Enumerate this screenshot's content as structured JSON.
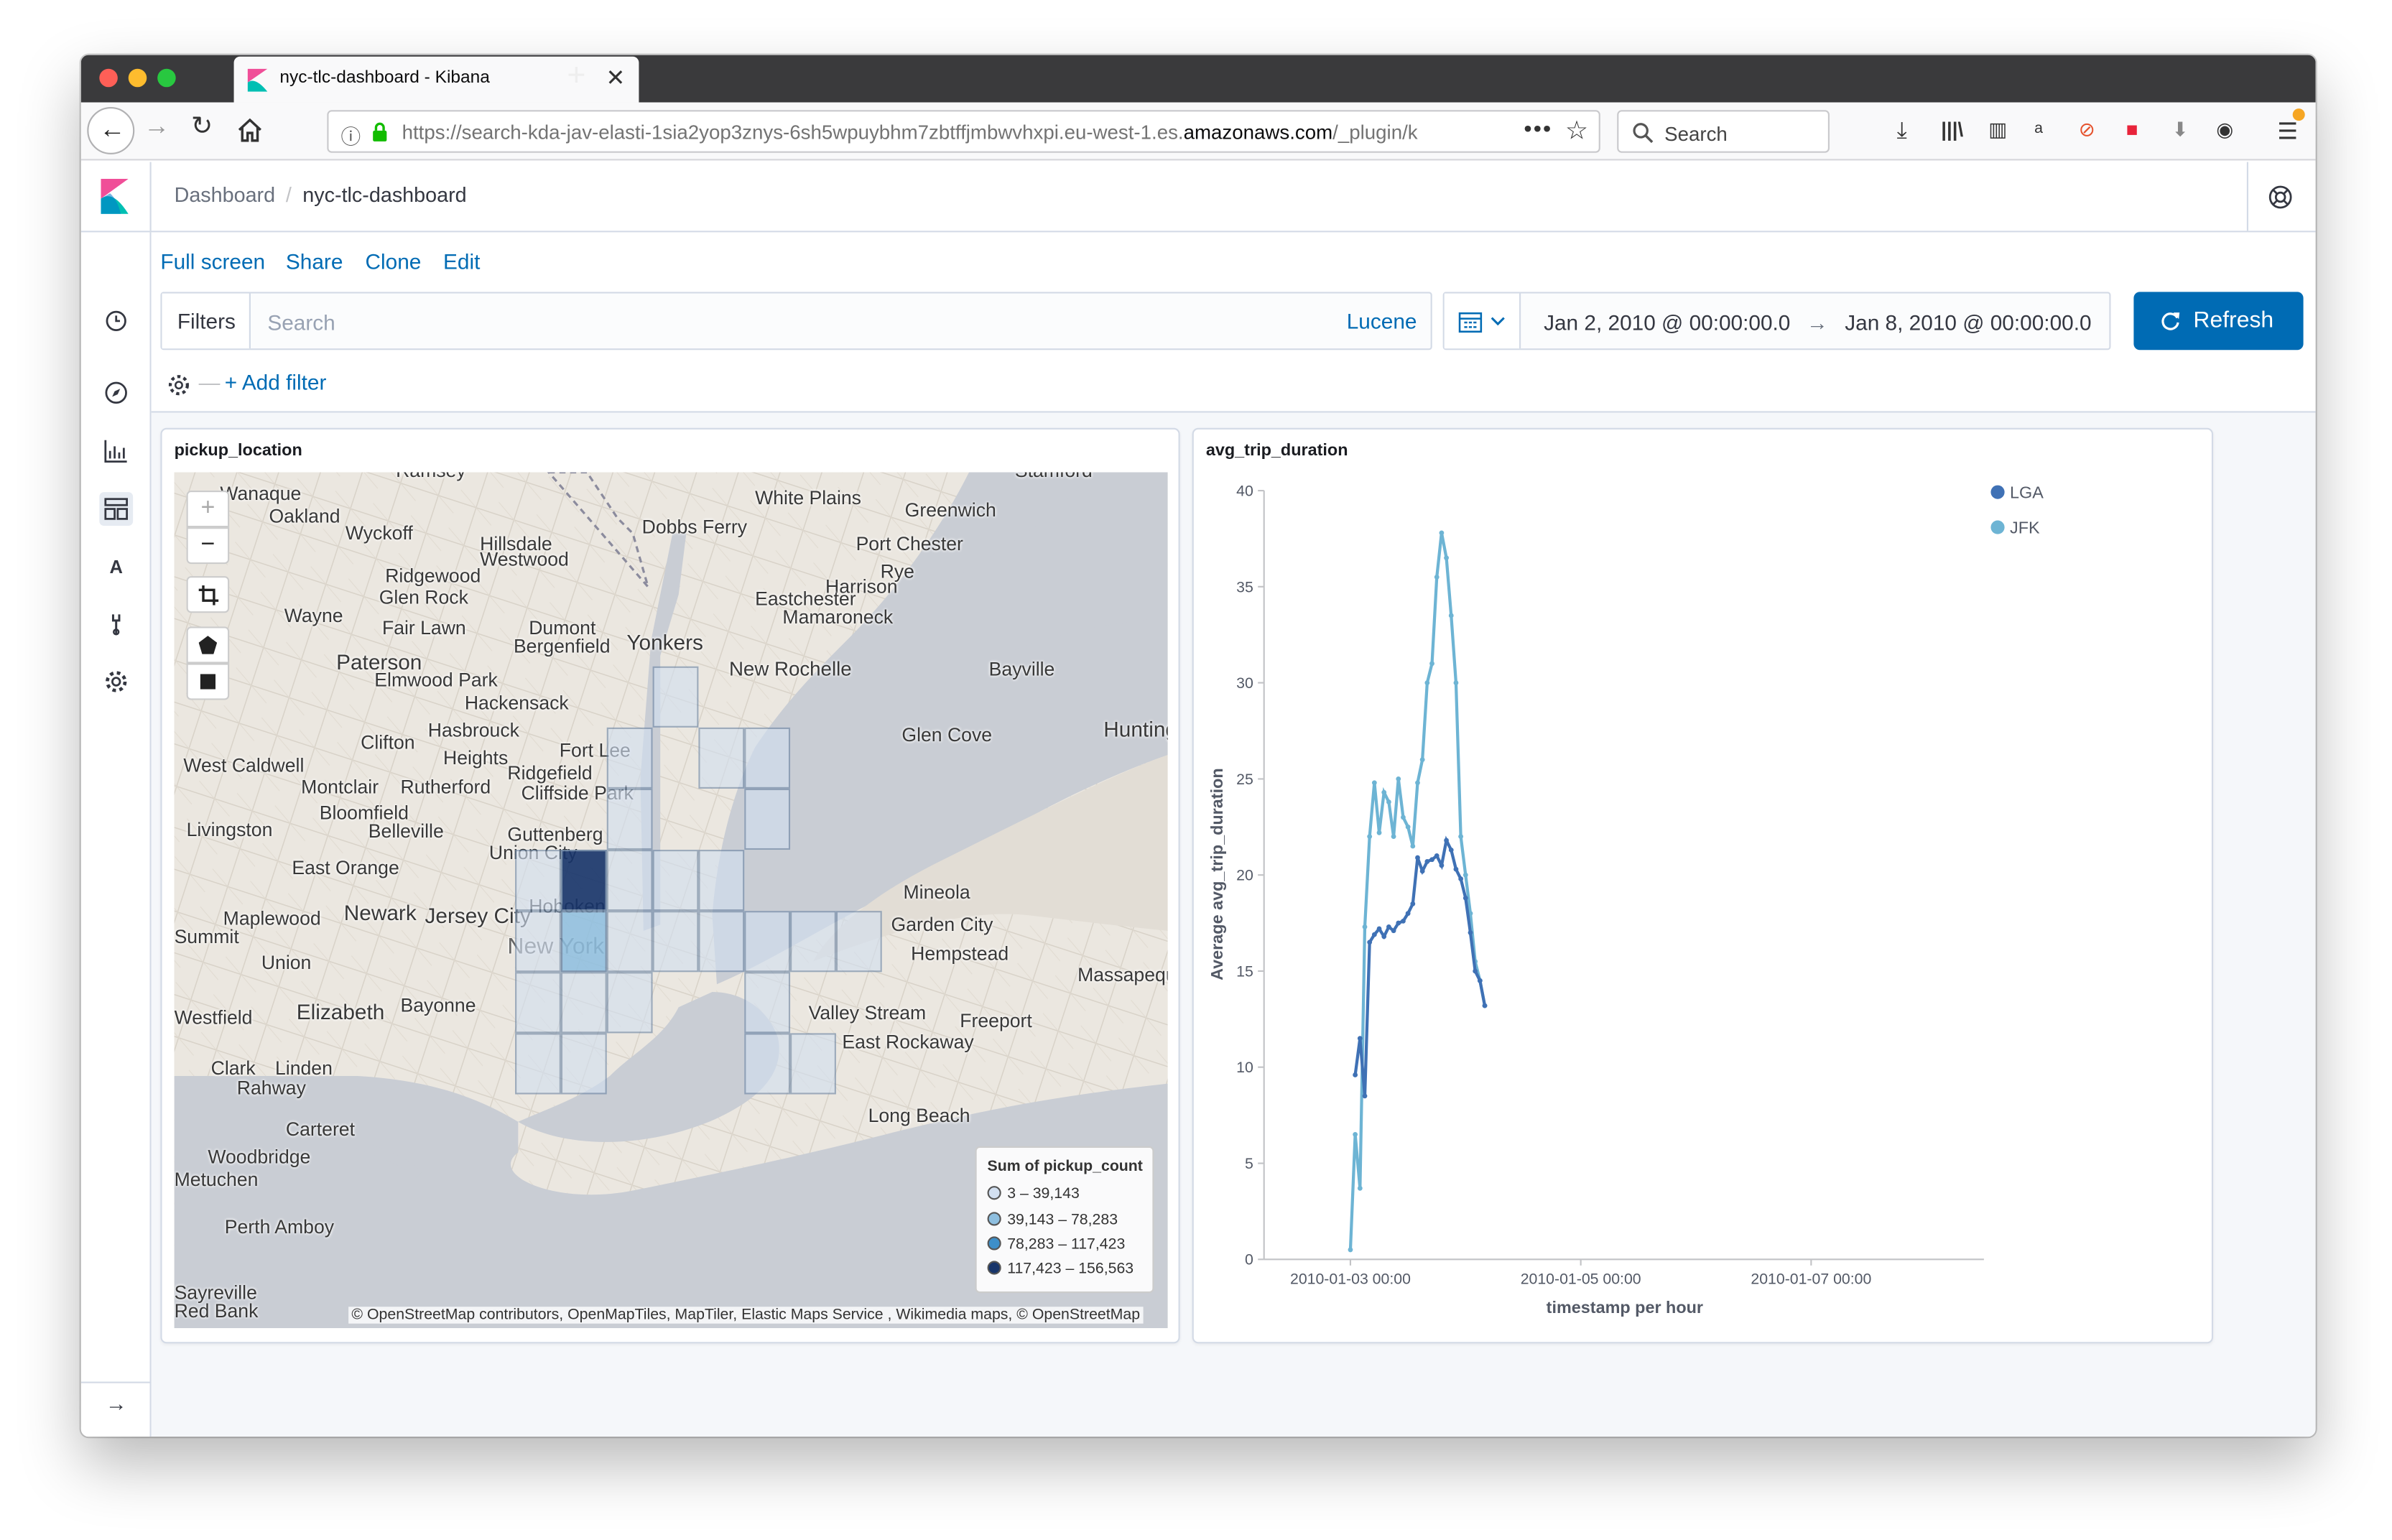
{
  "browser": {
    "tab_title": "nyc-tlc-dashboard - Kibana",
    "new_tab_symbol": "+",
    "url_prefix": "https://search-kda-jav-elasti-1sia2yop3znys-6sh5wpuybhm7zbtffjmbwvhxpi.eu-west-1.es.",
    "url_domain": "amazonaws.com",
    "url_suffix": "/_plugin/k",
    "search_placeholder": "Search",
    "colors": {
      "close": "#fe5f57",
      "minimize": "#febc2e",
      "zoom": "#28c840"
    }
  },
  "kibana": {
    "breadcrumb_root": "Dashboard",
    "breadcrumb_current": "nyc-tlc-dashboard",
    "menu": {
      "full_screen": "Full screen",
      "share": "Share",
      "clone": "Clone",
      "edit": "Edit"
    },
    "filters_label": "Filters",
    "query_placeholder": "Search",
    "query_language": "Lucene",
    "time_from": "Jan 2, 2010 @ 00:00:00.0",
    "time_arrow": "→",
    "time_to": "Jan 8, 2010 @ 00:00:00.0",
    "refresh_label": "Refresh",
    "add_filter_label": "+ Add filter",
    "accent": "#006bb4",
    "logo_colors": [
      "#f04e98",
      "#00bfb3",
      "#0077cc"
    ],
    "nav_icons": [
      "clock-icon",
      "compass-icon",
      "visualize-icon",
      "dashboard-icon",
      "canvas-icon",
      "wrench-icon",
      "gear-icon"
    ],
    "nav_letter": "A",
    "collapse_symbol": "→"
  },
  "map_panel": {
    "title": "pickup_location",
    "places": [
      "Ramsey",
      "Stamford",
      "White Plains",
      "Greenwich",
      "Oakland",
      "Dobbs Ferry",
      "Port Chester",
      "Wyckoff",
      "Hillsdale",
      "Westwood",
      "Ridgewood",
      "Glen Rock",
      "Harrison",
      "Rye",
      "Eastchester",
      "Mamaroneck",
      "Wayne",
      "Fair Lawn",
      "Dumont",
      "Bergenfield",
      "Yonkers",
      "New Rochelle",
      "Bayville",
      "Paterson",
      "Elmwood Park",
      "Hackensack",
      "Clifton",
      "Hasbrouck",
      "Heights",
      "Fort Lee",
      "Glen Cove",
      "Huntington",
      "West Caldwell",
      "Montclair",
      "Rutherford",
      "Ridgefield",
      "Cliffside Park",
      "Bloomfield",
      "Livingston",
      "Belleville",
      "Guttenberg",
      "Union City",
      "East Orange",
      "Mineola",
      "Maplewood",
      "Newark",
      "Jersey City",
      "Hoboken",
      "Garden City",
      "Summit",
      "New York",
      "Hempstead",
      "Union",
      "Elizabeth",
      "Bayonne",
      "Westfield",
      "Valley Stream",
      "Freeport",
      "East Rockaway",
      "Massapequa",
      "Clark",
      "Linden",
      "Rahway",
      "Long Beach",
      "Carteret",
      "Woodbridge",
      "Metuchen",
      "Perth Amboy",
      "Sayreville",
      "Red Bank",
      "Wanaque"
    ],
    "legend_title": "Sum of pickup_count",
    "legend": [
      {
        "label": "3 – 39,143",
        "color": "#d2dff0"
      },
      {
        "label": "39,143 – 78,283",
        "color": "#8ebfe0"
      },
      {
        "label": "78,283 – 117,423",
        "color": "#3d8fc9"
      },
      {
        "label": "117,423 – 156,563",
        "color": "#17346a"
      }
    ],
    "attribution": "© OpenStreetMap contributors, OpenMapTiles, MapTiler, Elastic Maps Service , Wikimedia maps, © OpenStreetMap",
    "controls": [
      "zoom-in-icon",
      "zoom-out-icon",
      "crop-icon",
      "polygon-icon",
      "rectangle-icon"
    ],
    "zoom_in": "+",
    "zoom_out": "−"
  },
  "chart_panel": {
    "title": "avg_trip_duration"
  },
  "chart_data": {
    "type": "line",
    "title": "avg_trip_duration",
    "xlabel": "timestamp per hour",
    "ylabel": "Average avg_trip_duration",
    "ylim": [
      0,
      40
    ],
    "xlim": [
      "2010-01-02 06:00",
      "2010-01-08 12:00"
    ],
    "yticks": [
      0,
      5,
      10,
      15,
      20,
      25,
      30,
      35,
      40
    ],
    "xticks": [
      "2010-01-03 00:00",
      "2010-01-05 00:00",
      "2010-01-07 00:00"
    ],
    "legend_position": "top-right",
    "series": [
      {
        "name": "LGA",
        "color": "#3f71b5",
        "x": [
          "2010-01-03 01:00",
          "2010-01-03 02:00",
          "2010-01-03 03:00",
          "2010-01-03 04:00",
          "2010-01-03 05:00",
          "2010-01-03 06:00",
          "2010-01-03 07:00",
          "2010-01-03 08:00",
          "2010-01-03 09:00",
          "2010-01-03 10:00",
          "2010-01-03 11:00",
          "2010-01-03 12:00",
          "2010-01-03 13:00",
          "2010-01-03 14:00",
          "2010-01-03 15:00",
          "2010-01-03 16:00",
          "2010-01-03 17:00",
          "2010-01-03 18:00",
          "2010-01-03 19:00",
          "2010-01-03 20:00",
          "2010-01-03 21:00",
          "2010-01-03 22:00",
          "2010-01-03 23:00",
          "2010-01-04 00:00",
          "2010-01-04 01:00",
          "2010-01-04 02:00",
          "2010-01-04 03:00",
          "2010-01-04 04:00"
        ],
        "values": [
          9.6,
          11.5,
          8.5,
          16.5,
          16.9,
          17.2,
          16.8,
          17.3,
          17.1,
          17.5,
          17.6,
          18.0,
          18.5,
          20.9,
          20.2,
          20.7,
          20.8,
          21.0,
          20.5,
          21.8,
          21.3,
          20.3,
          19.8,
          18.8,
          17.0,
          15.0,
          14.5,
          13.2
        ]
      },
      {
        "name": "JFK",
        "color": "#6db4d4",
        "x": [
          "2010-01-03 00:00",
          "2010-01-03 01:00",
          "2010-01-03 02:00",
          "2010-01-03 03:00",
          "2010-01-03 04:00",
          "2010-01-03 05:00",
          "2010-01-03 06:00",
          "2010-01-03 07:00",
          "2010-01-03 08:00",
          "2010-01-03 09:00",
          "2010-01-03 10:00",
          "2010-01-03 11:00",
          "2010-01-03 12:00",
          "2010-01-03 13:00",
          "2010-01-03 14:00",
          "2010-01-03 15:00",
          "2010-01-03 16:00",
          "2010-01-03 17:00",
          "2010-01-03 18:00",
          "2010-01-03 19:00",
          "2010-01-03 20:00",
          "2010-01-03 21:00",
          "2010-01-03 22:00",
          "2010-01-03 23:00",
          "2010-01-04 00:00",
          "2010-01-04 01:00",
          "2010-01-04 02:00",
          "2010-01-04 03:00",
          "2010-01-04 04:00"
        ],
        "values": [
          0.5,
          6.5,
          3.7,
          17.3,
          22.0,
          24.8,
          22.2,
          24.3,
          23.8,
          22.0,
          25.0,
          23.0,
          22.5,
          21.5,
          24.8,
          26.0,
          30.0,
          31.0,
          35.5,
          37.8,
          36.5,
          33.5,
          30.0,
          22.0,
          20.0,
          18.0,
          15.5,
          14.5,
          13.2
        ]
      }
    ]
  }
}
